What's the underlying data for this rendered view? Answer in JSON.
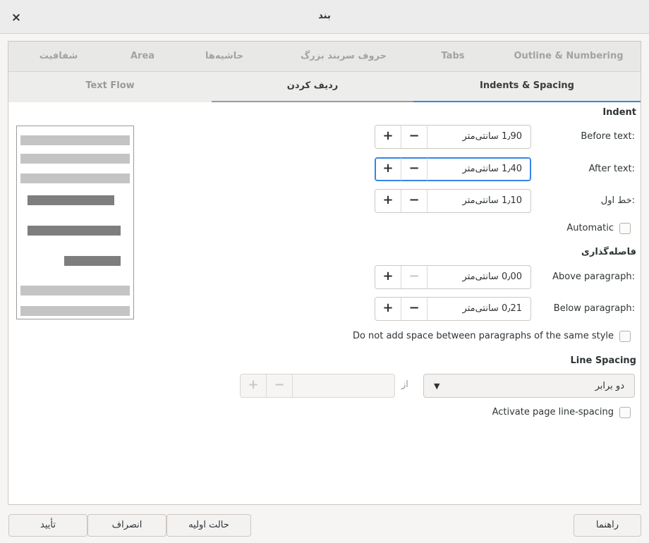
{
  "window": {
    "title": "بند",
    "close_glyph": "×"
  },
  "tabs_top": [
    "شفافیت",
    "Area",
    "حاشیه‌ها",
    "حروف سربند بزرگ",
    "Tabs",
    "Outline & Numbering"
  ],
  "tabs_second": [
    "Text Flow",
    "ردیف کردن",
    "Indents & Spacing"
  ],
  "indent": {
    "heading": "Indent",
    "before_text": {
      "label": "Before text:",
      "value": "1٫90 سانتی‌متر"
    },
    "after_text": {
      "label": "After text:",
      "value": "1٫40 سانتی‌متر"
    },
    "first_line": {
      "label": "خط اول:",
      "value": "1٫10 سانتی‌متر"
    },
    "automatic_label": "Automatic"
  },
  "spacing": {
    "heading": "فاصله‌گذاری",
    "above": {
      "label": "Above paragraph:",
      "value": "0٫00 سانتی‌متر"
    },
    "below": {
      "label": "Below paragraph:",
      "value": "0٫21 سانتی‌متر"
    },
    "no_space_label": "Do not add space between paragraphs of the same style"
  },
  "line_spacing": {
    "heading": "Line Spacing",
    "selected": "دو برابر",
    "of_label": "از",
    "activate_label": "Activate page line-spacing"
  },
  "footer": {
    "help": "راهنما",
    "reset": "حالت اولیه",
    "cancel": "انصراف",
    "ok": "تأیید"
  },
  "spin_glyphs": {
    "plus": "+",
    "minus": "−"
  },
  "colors": {
    "accent": "#3584e4",
    "tab_active_bar": "#3584e4",
    "tab_inactive_bar": "#9a9a9a"
  }
}
